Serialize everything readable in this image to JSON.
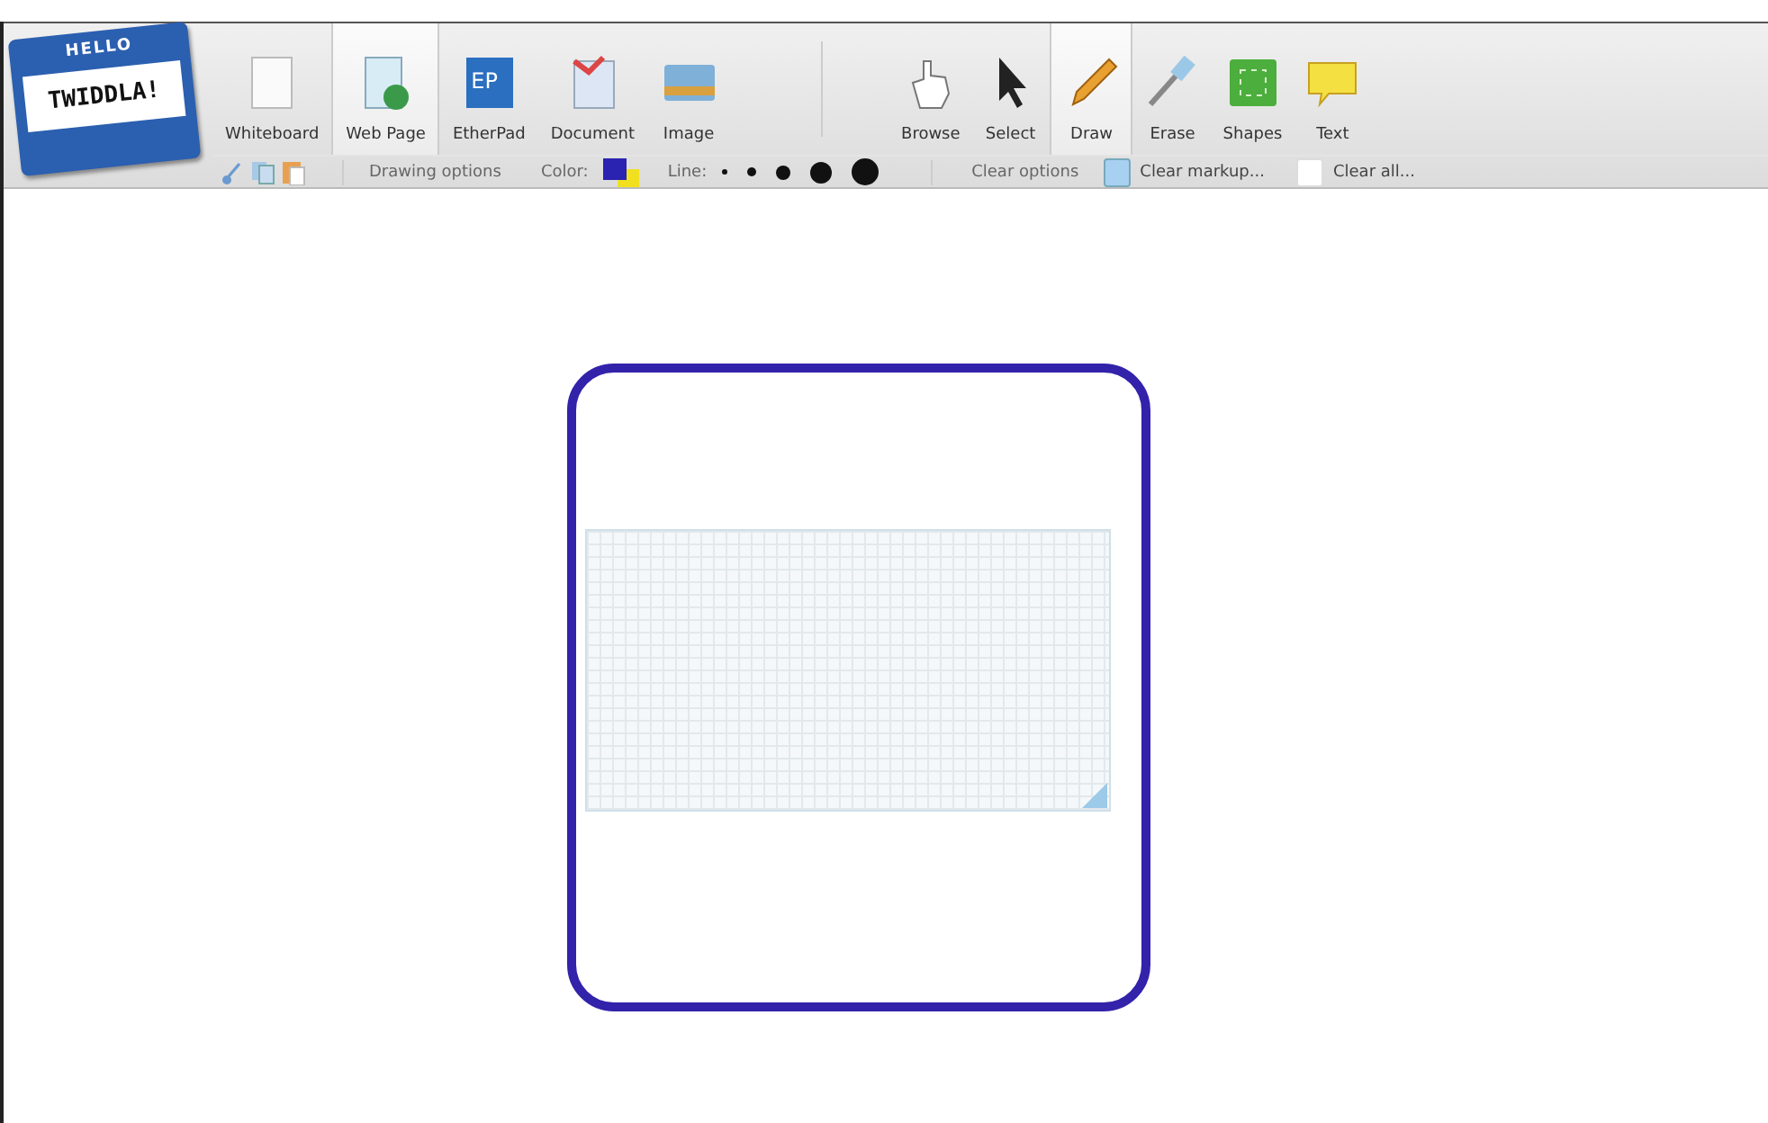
{
  "logo": {
    "top": "HELLO",
    "name": "TWIDDLA!"
  },
  "content_tools": [
    {
      "label": "Whiteboard",
      "kind": "whiteboard",
      "selected": false
    },
    {
      "label": "Web Page",
      "kind": "webpage",
      "selected": true
    },
    {
      "label": "EtherPad",
      "kind": "etherpad",
      "selected": false,
      "badge": "EP"
    },
    {
      "label": "Document",
      "kind": "document",
      "selected": false
    },
    {
      "label": "Image",
      "kind": "image",
      "selected": false
    }
  ],
  "mode_tools": [
    {
      "label": "Browse",
      "kind": "browse",
      "selected": false
    },
    {
      "label": "Select",
      "kind": "select",
      "selected": false
    },
    {
      "label": "Draw",
      "kind": "draw",
      "selected": true
    },
    {
      "label": "Erase",
      "kind": "erase",
      "selected": false
    },
    {
      "label": "Shapes",
      "kind": "shapes",
      "selected": false
    },
    {
      "label": "Text",
      "kind": "text",
      "selected": false
    }
  ],
  "options_bar": {
    "drawing_options": "Drawing options",
    "color_label": "Color:",
    "line_label": "Line:",
    "clear_options": "Clear options",
    "clear_markup": "Clear markup...",
    "clear_all": "Clear all..."
  }
}
